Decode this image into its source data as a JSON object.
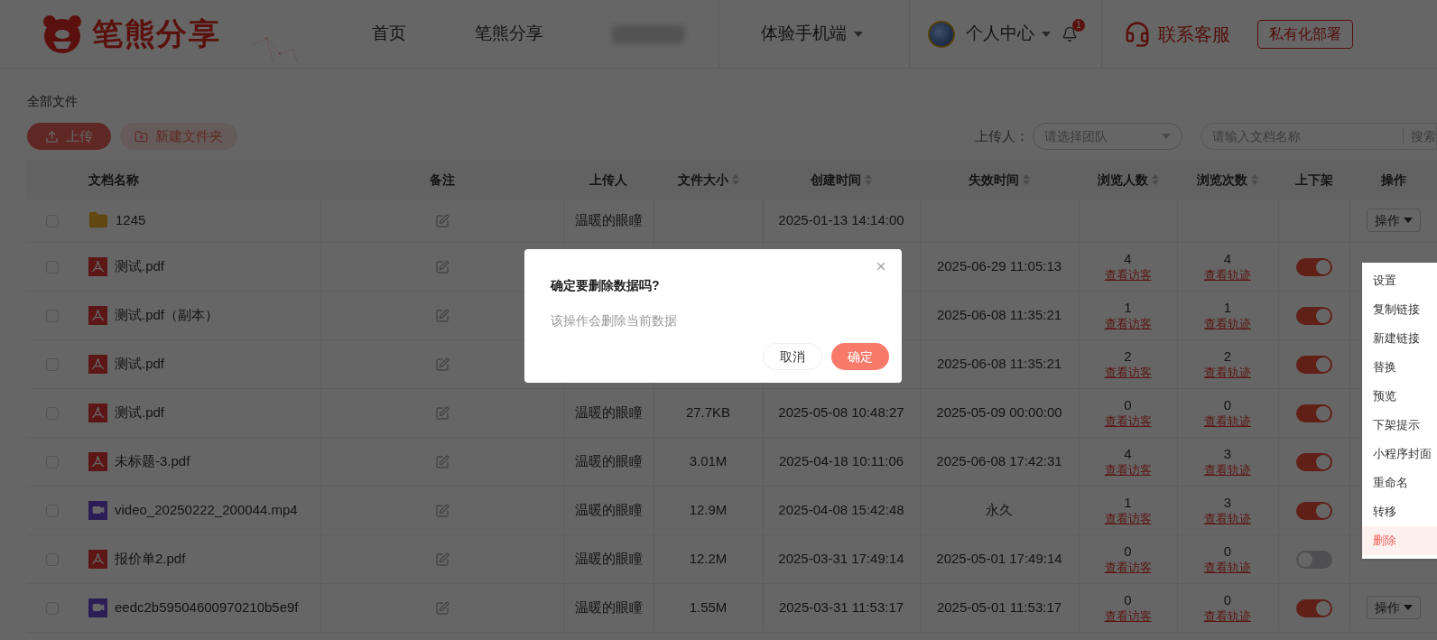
{
  "header": {
    "logo": "笔熊分享",
    "nav": [
      {
        "kind": "link",
        "label": "首页"
      },
      {
        "kind": "link",
        "label": "笔熊分享"
      },
      {
        "kind": "blurred"
      },
      {
        "kind": "dropdown",
        "label": "体验手机端"
      }
    ],
    "user": {
      "label": "个人中心"
    },
    "notifications": {
      "badge": "1"
    },
    "support": "联系客服",
    "deploy_button": "私有化部署"
  },
  "breadcrumb": "全部文件",
  "toolbar": {
    "upload": "上传",
    "new_folder": "新建文件夹",
    "uploader_label": "上传人：",
    "uploader_select": {
      "placeholder": "请选择团队"
    },
    "search": {
      "placeholder": "请输入文档名称",
      "button": "搜索"
    }
  },
  "table": {
    "columns": [
      {
        "label": "文档名称",
        "sortable": false
      },
      {
        "label": "备注",
        "sortable": false
      },
      {
        "label": "上传人",
        "sortable": false
      },
      {
        "label": "文件大小",
        "sortable": true
      },
      {
        "label": "创建时间",
        "sortable": true
      },
      {
        "label": "失效时间",
        "sortable": true
      },
      {
        "label": "浏览人数",
        "sortable": true
      },
      {
        "label": "浏览次数",
        "sortable": true
      },
      {
        "label": "上下架",
        "sortable": false
      },
      {
        "label": "操作",
        "sortable": false
      }
    ],
    "rows": [
      {
        "kind": "folder",
        "checked": false,
        "name": "1245",
        "uploader": "温暖的眼瞳",
        "created": "2025-01-13 14:14:00",
        "action": "操作"
      },
      {
        "kind": "pdf",
        "checked": false,
        "name": "测试.pdf",
        "expiry": "2025-06-29 11:05:13",
        "viewers": "4",
        "visitors_link": "查看访客",
        "views": "4",
        "trace_link": "查看轨迹",
        "on": true
      },
      {
        "kind": "pdf",
        "checked": false,
        "name": "测试.pdf（副本）",
        "expiry": "2025-06-08 11:35:21",
        "viewers": "1",
        "visitors_link": "查看访客",
        "views": "1",
        "trace_link": "查看轨迹",
        "on": true
      },
      {
        "kind": "pdf",
        "checked": false,
        "name": "测试.pdf",
        "expiry": "2025-06-08 11:35:21",
        "viewers": "2",
        "visitors_link": "查看访客",
        "views": "2",
        "trace_link": "查看轨迹",
        "on": true
      },
      {
        "kind": "pdf",
        "checked": false,
        "name": "测试.pdf",
        "uploader": "温暖的眼瞳",
        "size": "27.7KB",
        "created": "2025-05-08 10:48:27",
        "expiry": "2025-05-09 00:00:00",
        "viewers": "0",
        "visitors_link": "查看访客",
        "views": "0",
        "trace_link": "查看轨迹",
        "on": true
      },
      {
        "kind": "pdf",
        "checked": false,
        "name": "未标题-3.pdf",
        "uploader": "温暖的眼瞳",
        "size": "3.01M",
        "created": "2025-04-18 10:11:06",
        "expiry": "2025-06-08 17:42:31",
        "viewers": "4",
        "visitors_link": "查看访客",
        "views": "3",
        "trace_link": "查看轨迹",
        "on": true
      },
      {
        "kind": "video",
        "checked": false,
        "name": "video_20250222_200044.mp4",
        "uploader": "温暖的眼瞳",
        "size": "12.9M",
        "created": "2025-04-08 15:42:48",
        "expiry": "永久",
        "viewers": "1",
        "visitors_link": "查看访客",
        "views": "3",
        "trace_link": "查看轨迹",
        "on": true
      },
      {
        "kind": "pdf",
        "checked": false,
        "name": "报价单2.pdf",
        "uploader": "温暖的眼瞳",
        "size": "12.2M",
        "created": "2025-03-31 17:49:14",
        "expiry": "2025-05-01 17:49:14",
        "viewers": "0",
        "visitors_link": "查看访客",
        "views": "0",
        "trace_link": "查看轨迹",
        "on": false
      },
      {
        "kind": "video",
        "checked": false,
        "name": "eedc2b59504600970210b5e9f",
        "uploader": "温暖的眼瞳",
        "size": "1.55M",
        "created": "2025-03-31 11:53:17",
        "expiry": "2025-05-01 11:53:17",
        "viewers": "0",
        "visitors_link": "查看访客",
        "views": "0",
        "trace_link": "查看轨迹",
        "on": true,
        "action": "操作"
      }
    ]
  },
  "action_menu": {
    "items": [
      {
        "label": "设置",
        "selected": false
      },
      {
        "label": "复制链接",
        "selected": false
      },
      {
        "label": "新建链接",
        "selected": false
      },
      {
        "label": "替换",
        "selected": false
      },
      {
        "label": "预览",
        "selected": false
      },
      {
        "label": "下架提示",
        "selected": false
      },
      {
        "label": "小程序封面",
        "selected": false
      },
      {
        "label": "重命名",
        "selected": false
      },
      {
        "label": "转移",
        "selected": false
      },
      {
        "label": "删除",
        "selected": true
      }
    ]
  },
  "dialog": {
    "title": "确定要删除数据吗?",
    "message": "该操作会删除当前数据",
    "cancel": "取消",
    "confirm": "确定"
  }
}
